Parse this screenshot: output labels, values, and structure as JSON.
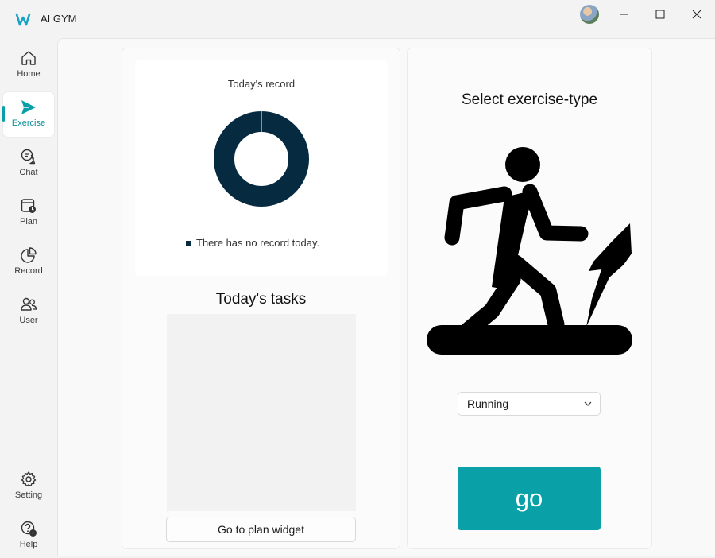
{
  "app": {
    "title": "AI GYM"
  },
  "sidebar": {
    "items": [
      {
        "label": "Home",
        "icon": "home-icon"
      },
      {
        "label": "Exercise",
        "icon": "send-icon",
        "active": true
      },
      {
        "label": "Chat",
        "icon": "chat-icon"
      },
      {
        "label": "Plan",
        "icon": "calendar-clock-icon"
      },
      {
        "label": "Record",
        "icon": "pie-chart-icon"
      },
      {
        "label": "User",
        "icon": "people-icon"
      }
    ],
    "bottom_items": [
      {
        "label": "Setting",
        "icon": "gear-icon"
      },
      {
        "label": "Help",
        "icon": "help-icon"
      }
    ]
  },
  "record": {
    "title": "Today's record",
    "legend": "There has no record today.",
    "donut_color": "#062a40"
  },
  "tasks": {
    "title": "Today's tasks",
    "button_label": "Go to plan widget"
  },
  "exercise": {
    "title": "Select exercise-type",
    "selected_type": "Running",
    "go_label": "go"
  },
  "colors": {
    "accent": "#0aa0a7",
    "donut": "#062a40"
  }
}
